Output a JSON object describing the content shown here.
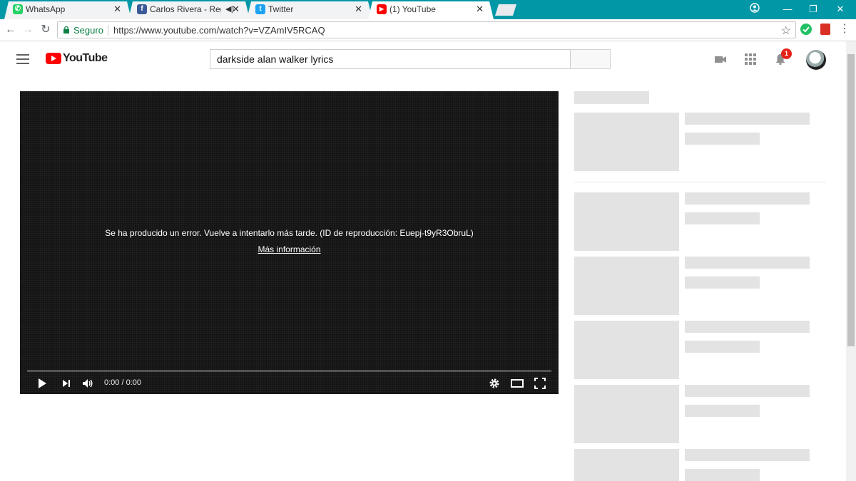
{
  "browser": {
    "tabs": [
      {
        "label": "WhatsApp",
        "favicon": "whatsapp-icon",
        "color": "#25d366"
      },
      {
        "label": "Carlos Rivera - Regrés",
        "favicon": "facebook-icon",
        "color": "#3b5998",
        "audio": true
      },
      {
        "label": "Twitter",
        "favicon": "twitter-icon",
        "color": "#1da1f2"
      },
      {
        "label": "(1) YouTube",
        "favicon": "youtube-icon",
        "color": "#ff0000",
        "active": true
      }
    ],
    "secure_label": "Seguro",
    "url": "https://www.youtube.com/watch?v=VZAmIV5RCAQ"
  },
  "youtube": {
    "logo_text": "YouTube",
    "search_value": "darkside alan walker lyrics",
    "notifications_count": "1"
  },
  "player": {
    "error_message": "Se ha producido un error. Vuelve a intentarlo más tarde. (ID de reproducción: Euepj-t9yR3ObruL)",
    "more_info_link": "Más información",
    "time": "0:00 / 0:00"
  },
  "colors": {
    "chrome_frame": "#0097a7",
    "youtube_red": "#ff0000",
    "skeleton": "#e3e3e3"
  }
}
